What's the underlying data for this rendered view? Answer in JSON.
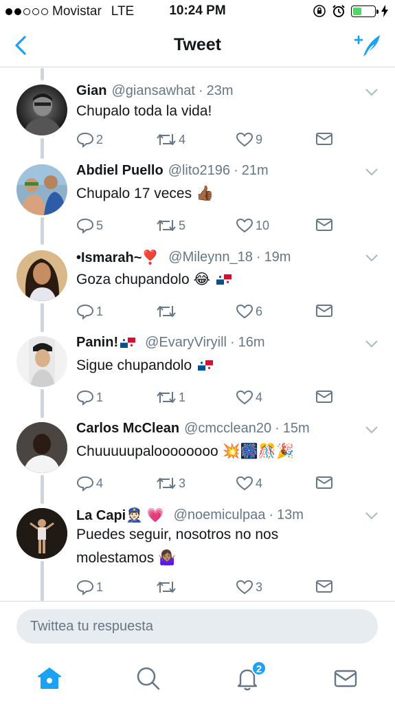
{
  "status_bar": {
    "carrier": "Movistar",
    "network": "LTE",
    "time": "10:24 PM",
    "signal_bars_filled": 2,
    "signal_bars_total": 5,
    "battery_level": 0.4
  },
  "navbar": {
    "title": "Tweet",
    "back_icon": "chevron-left-icon",
    "compose_icon": "compose-tweet-icon"
  },
  "colors": {
    "accent": "#1da1f2",
    "muted": "#657786",
    "battery": "#4cd964"
  },
  "tweets": [
    {
      "name": "Gian",
      "handle": "@giansawhat",
      "time": "23m",
      "text": "Chupalo toda la vida!",
      "replies": "2",
      "retweets": "4",
      "likes": "9"
    },
    {
      "name": "Abdiel Puello",
      "handle": "@lito2196",
      "time": "21m",
      "text": "Chupalo 17 veces 👍🏾",
      "replies": "5",
      "retweets": "5",
      "likes": "10"
    },
    {
      "name": "•Ismarah~❣️",
      "handle": "@Mileynn_18",
      "time": "19m",
      "text": "Goza chupandolo 😂",
      "replies": "1",
      "retweets": "",
      "likes": "6"
    },
    {
      "name": "Panin!",
      "handle": "@EvaryViryill",
      "time": "16m",
      "text": "Sigue chupandolo",
      "replies": "1",
      "retweets": "1",
      "likes": "4"
    },
    {
      "name": "Carlos McClean",
      "handle": "@cmcclean20",
      "time": "15m",
      "text": "Chuuuuupaloooooooo 💥🎆🎊🎉",
      "replies": "4",
      "retweets": "3",
      "likes": "4"
    },
    {
      "name": "La Capi👮🏻 💗",
      "handle": "@noemiculpaa",
      "time": "13m",
      "text_line1": "Puedes seguir, nosotros no nos",
      "text_line2": "molestamos 🤷🏽‍♀️",
      "replies": "1",
      "retweets": "",
      "likes": "3"
    }
  ],
  "reply": {
    "placeholder": "Twittea tu respuesta",
    "value": ""
  },
  "tabbar": {
    "notifications_badge": "2",
    "active_tab": "home"
  }
}
